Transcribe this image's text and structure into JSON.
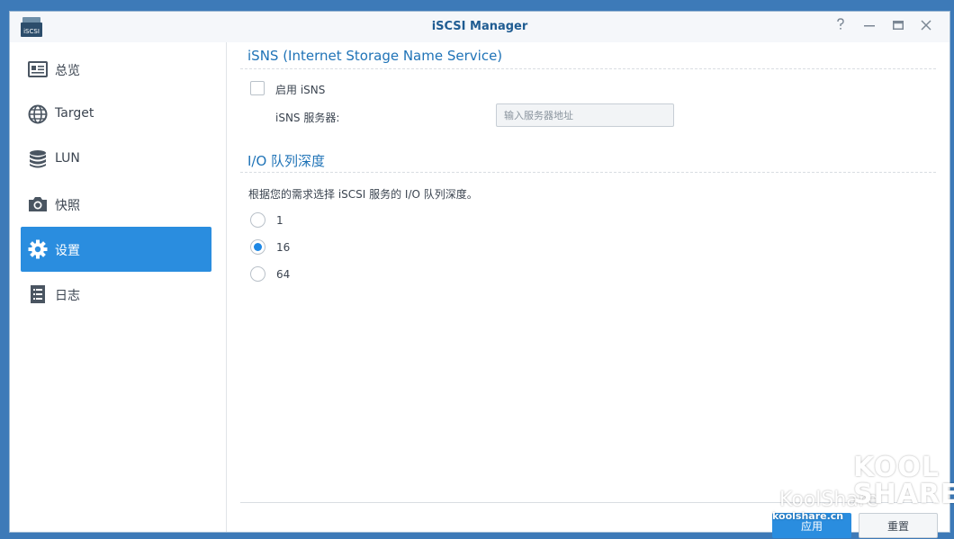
{
  "window": {
    "title": "iSCSI Manager",
    "app_icon_text": "iSCSI"
  },
  "sidebar": {
    "items": [
      {
        "label": "总览",
        "icon": "overview-icon",
        "active": false
      },
      {
        "label": "Target",
        "icon": "globe-icon",
        "active": false
      },
      {
        "label": "LUN",
        "icon": "database-icon",
        "active": false
      },
      {
        "label": "快照",
        "icon": "camera-icon",
        "active": false
      },
      {
        "label": "设置",
        "icon": "gear-icon",
        "active": true
      },
      {
        "label": "日志",
        "icon": "log-icon",
        "active": false
      }
    ]
  },
  "isns": {
    "section_title": "iSNS (Internet Storage Name Service)",
    "enable_label": "启用 iSNS",
    "enabled": false,
    "server_label": "iSNS 服务器:",
    "server_value": "",
    "server_placeholder": "输入服务器地址"
  },
  "queue": {
    "section_title": "I/O 队列深度",
    "description": "根据您的需求选择 iSCSI 服务的 I/O 队列深度。",
    "options": [
      {
        "label": "1",
        "selected": false
      },
      {
        "label": "16",
        "selected": true
      },
      {
        "label": "64",
        "selected": false
      }
    ]
  },
  "footer": {
    "apply_label": "应用",
    "reset_label": "重置"
  },
  "watermark": {
    "brand": "KoolShare",
    "url": "koolshare.cn",
    "logo": "KOOL SHARE"
  },
  "colors": {
    "accent": "#2a8ddf",
    "title": "#1f5c92",
    "section": "#1f73b7",
    "desktop": "#3d7ab8"
  }
}
